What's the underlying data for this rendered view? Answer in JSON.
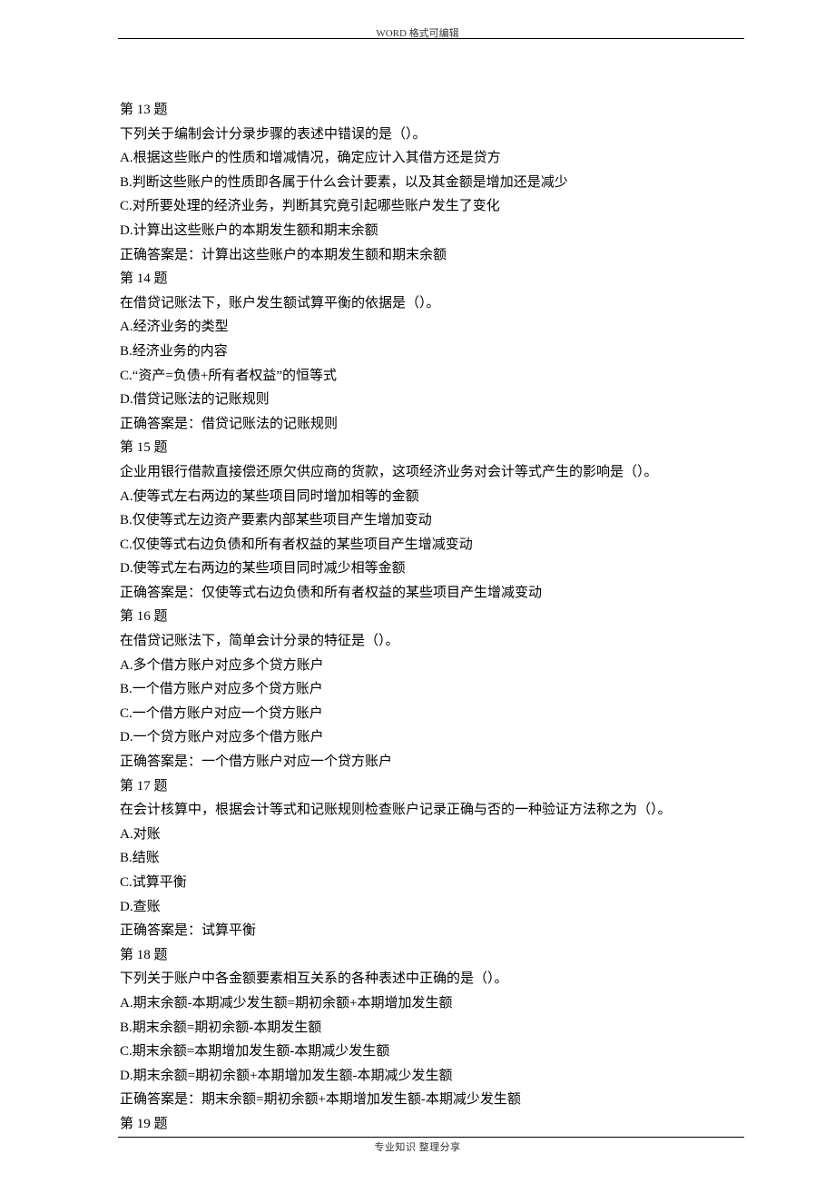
{
  "header": {
    "text": "WORD 格式可编辑"
  },
  "footer": {
    "text": "专业知识   整理分享"
  },
  "questions": [
    {
      "heading": "第 13 题",
      "stem": "下列关于编制会计分录步骤的表述中错误的是（）。",
      "options": [
        "A.根据这些账户的性质和增减情况，确定应计入其借方还是贷方",
        "B.判断这些账户的性质即各属于什么会计要素，以及其金额是增加还是减少",
        "C.对所要处理的经济业务，判断其究竟引起哪些账户发生了变化",
        "D.计算出这些账户的本期发生额和期末余额"
      ],
      "answer": "正确答案是：计算出这些账户的本期发生额和期末余额"
    },
    {
      "heading": "第 14 题",
      "stem": "在借贷记账法下，账户发生额试算平衡的依据是（）。",
      "options": [
        "A.经济业务的类型",
        "B.经济业务的内容",
        "C.“资产=负债+所有者权益”的恒等式",
        "D.借贷记账法的记账规则"
      ],
      "answer": "正确答案是：借贷记账法的记账规则"
    },
    {
      "heading": "第 15 题",
      "stem": "企业用银行借款直接偿还原欠供应商的货款，这项经济业务对会计等式产生的影响是（）。",
      "options": [
        "A.使等式左右两边的某些项目同时增加相等的金额",
        "B.仅使等式左边资产要素内部某些项目产生增加变动",
        "C.仅使等式右边负债和所有者权益的某些项目产生增减变动",
        "D.使等式左右两边的某些项目同时减少相等金额"
      ],
      "answer": "正确答案是：仅使等式右边负债和所有者权益的某些项目产生增减变动"
    },
    {
      "heading": "第 16 题",
      "stem": "在借贷记账法下，简单会计分录的特征是（）。",
      "options": [
        "A.多个借方账户对应多个贷方账户",
        "B.一个借方账户对应多个贷方账户",
        "C.一个借方账户对应一个贷方账户",
        "D.一个贷方账户对应多个借方账户"
      ],
      "answer": "正确答案是：一个借方账户对应一个贷方账户"
    },
    {
      "heading": "第 17 题",
      "stem": "在会计核算中，根据会计等式和记账规则检查账户记录正确与否的一种验证方法称之为（）。",
      "options": [
        "A.对账",
        "B.结账",
        "C.试算平衡",
        "D.查账"
      ],
      "answer": "正确答案是：试算平衡"
    },
    {
      "heading": "第 18 题",
      "stem": "下列关于账户中各金额要素相互关系的各种表述中正确的是（）。",
      "options": [
        "A.期末余额-本期减少发生额=期初余额+本期增加发生额",
        "B.期末余额=期初余额-本期发生额",
        "C.期末余额=本期增加发生额-本期减少发生额",
        "D.期末余额=期初余额+本期增加发生额-本期减少发生额"
      ],
      "answer": "正确答案是：期末余额=期初余额+本期增加发生额-本期减少发生额"
    },
    {
      "heading": "第 19 题",
      "stem": "",
      "options": [],
      "answer": ""
    }
  ]
}
